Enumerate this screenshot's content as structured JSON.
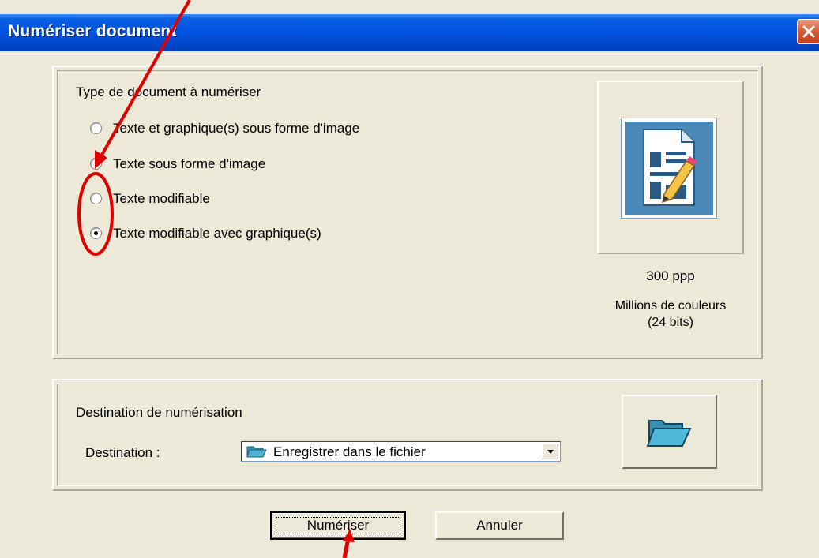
{
  "window": {
    "title": "Numériser document"
  },
  "document_type": {
    "heading": "Type de document à numériser",
    "options": [
      {
        "label": "Texte et graphique(s) sous forme d'image",
        "selected": false
      },
      {
        "label": "Texte sous forme d'image",
        "selected": false
      },
      {
        "label": "Texte modifiable",
        "selected": false
      },
      {
        "label": "Texte modifiable avec graphique(s)",
        "selected": true
      }
    ]
  },
  "preview": {
    "icon": "document-edit-icon",
    "resolution": "300 ppp",
    "color_line1": "Millions de couleurs",
    "color_line2": "(24 bits)"
  },
  "destination": {
    "heading": "Destination de numérisation",
    "label": "Destination :",
    "selected": "Enregistrer dans le fichier",
    "icon": "folder-icon"
  },
  "buttons": {
    "scan": "Numériser",
    "cancel": "Annuler"
  },
  "annotations": {
    "color": "#e00000"
  }
}
